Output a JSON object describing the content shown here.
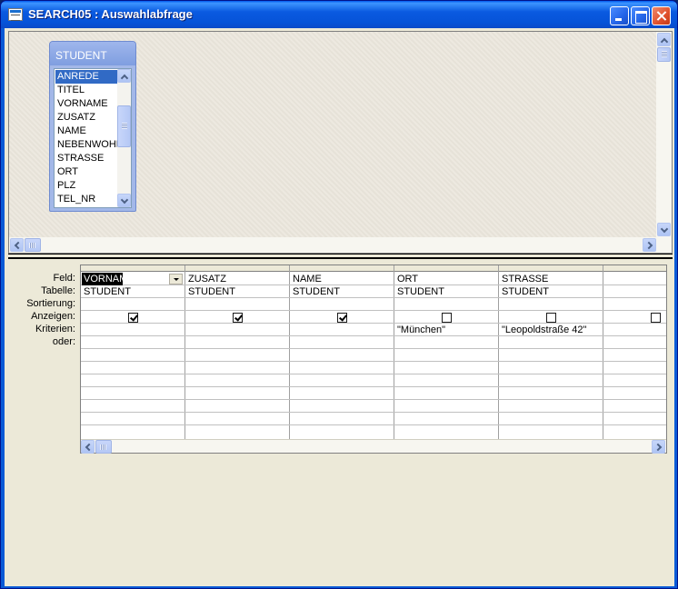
{
  "window": {
    "title": "SEARCH05 : Auswahlabfrage"
  },
  "field_list": {
    "table_name": "STUDENT",
    "fields": [
      "ANREDE",
      "TITEL",
      "VORNAME",
      "ZUSATZ",
      "NAME",
      "NEBENWOHN",
      "STRASSE",
      "ORT",
      "PLZ",
      "TEL_NR"
    ],
    "selected_field": "ANREDE"
  },
  "design_grid": {
    "row_labels": {
      "field": "Feld:",
      "table": "Tabelle:",
      "sort": "Sortierung:",
      "show": "Anzeigen:",
      "criteria": "Kriterien:",
      "or": "oder:"
    },
    "columns": [
      {
        "field": "VORNAME",
        "table": "STUDENT",
        "sort": "",
        "show": true,
        "criteria": "",
        "active": true
      },
      {
        "field": "ZUSATZ",
        "table": "STUDENT",
        "sort": "",
        "show": true,
        "criteria": ""
      },
      {
        "field": "NAME",
        "table": "STUDENT",
        "sort": "",
        "show": true,
        "criteria": ""
      },
      {
        "field": "ORT",
        "table": "STUDENT",
        "sort": "",
        "show": false,
        "criteria": "\"München\""
      },
      {
        "field": "STRASSE",
        "table": "STUDENT",
        "sort": "",
        "show": false,
        "criteria": "\"Leopoldstraße 42\""
      },
      {
        "field": "",
        "table": "",
        "sort": "",
        "show": false,
        "criteria": ""
      }
    ]
  },
  "colors": {
    "titlebar": "#0a5ae0",
    "selection": "#316ac5",
    "client": "#ece9d8"
  }
}
